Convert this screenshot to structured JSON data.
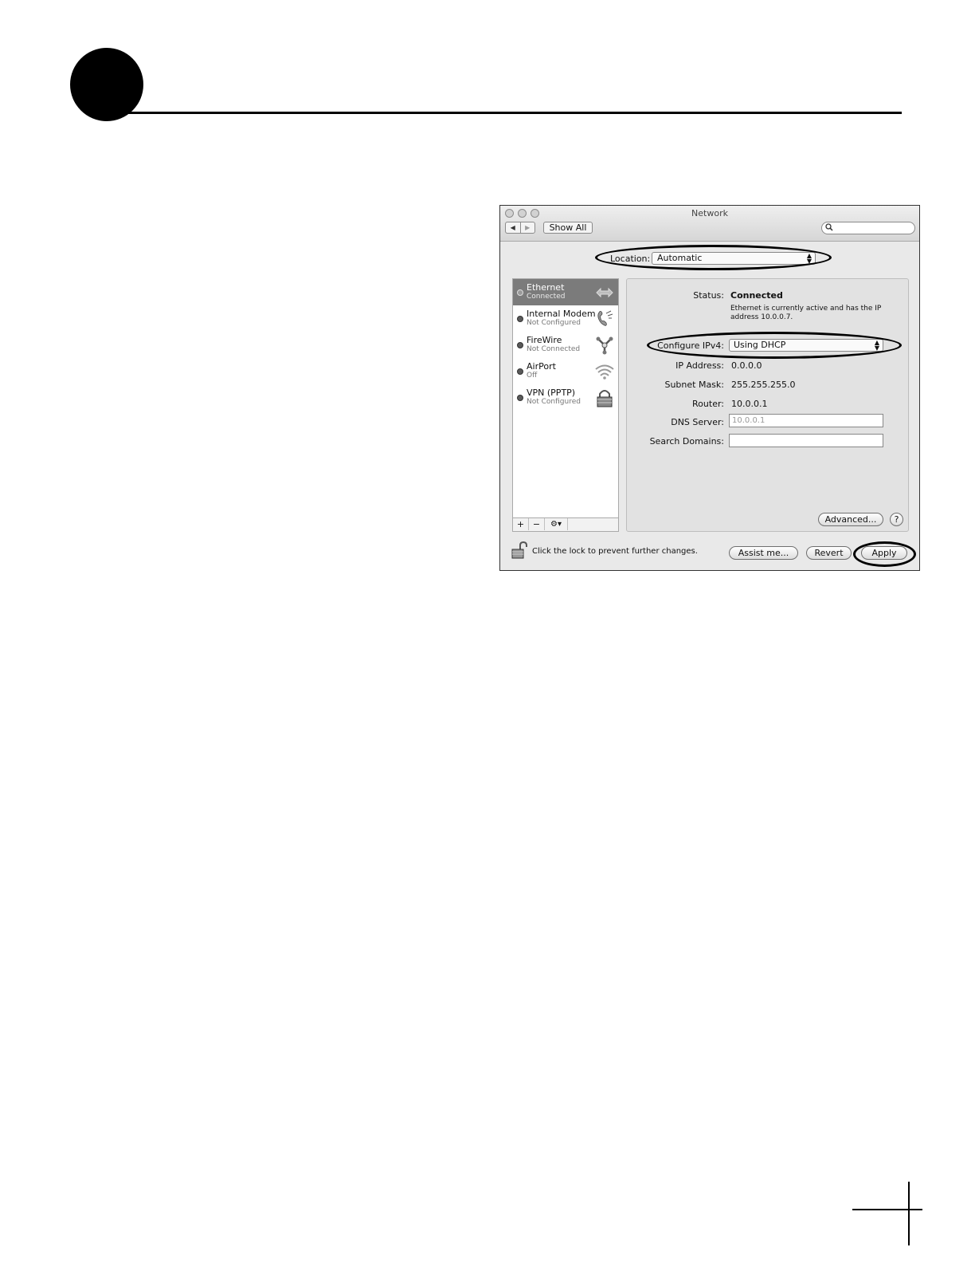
{
  "window": {
    "title": "Network",
    "toolbar": {
      "back_icon": "back-arrow-icon",
      "forward_icon": "forward-arrow-icon",
      "show_all": "Show All",
      "search_placeholder": "",
      "search_icon": "search-icon"
    },
    "location": {
      "label": "Location:",
      "value": "Automatic"
    },
    "services": [
      {
        "name": "Ethernet",
        "status": "Connected",
        "icon": "ethernet-icon",
        "selected": true
      },
      {
        "name": "Internal Modem",
        "status": "Not Configured",
        "icon": "modem-phone-icon",
        "selected": false
      },
      {
        "name": "FireWire",
        "status": "Not Connected",
        "icon": "firewire-icon",
        "selected": false
      },
      {
        "name": "AirPort",
        "status": "Off",
        "icon": "wifi-icon",
        "selected": false
      },
      {
        "name": "VPN (PPTP)",
        "status": "Not Configured",
        "icon": "vpn-lock-icon",
        "selected": false
      }
    ],
    "sidebar_controls": {
      "add": "+",
      "remove": "−",
      "action": "⚙▾"
    },
    "details": {
      "status_label": "Status:",
      "status_value": "Connected",
      "status_description": "Ethernet is currently active and has the IP address 10.0.0.7.",
      "configure_ipv4_label": "Configure IPv4:",
      "configure_ipv4_value": "Using DHCP",
      "ip_address_label": "IP Address:",
      "ip_address_value": "0.0.0.0",
      "subnet_mask_label": "Subnet Mask:",
      "subnet_mask_value": "255.255.255.0",
      "router_label": "Router:",
      "router_value": "10.0.0.1",
      "dns_server_label": "DNS Server:",
      "dns_server_placeholder": "10.0.0.1",
      "search_domains_label": "Search Domains:",
      "search_domains_value": "",
      "advanced_button": "Advanced...",
      "help_button": "?"
    },
    "footer": {
      "lock_text": "Click the lock to prevent further changes.",
      "assist_button": "Assist me...",
      "revert_button": "Revert",
      "apply_button": "Apply"
    }
  }
}
